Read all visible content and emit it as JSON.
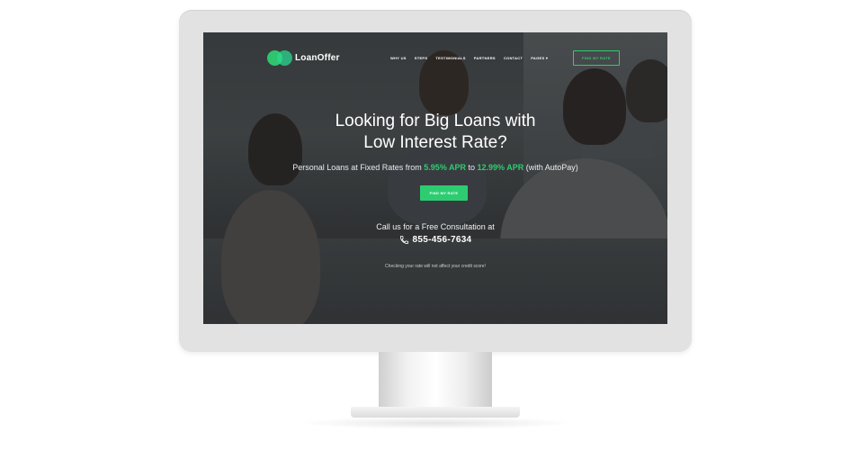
{
  "brand": {
    "name": "LoanOffer",
    "accent_color": "#2ecc71"
  },
  "nav": {
    "items": [
      "WHY US",
      "STEPS",
      "TESTIMONIALS",
      "PARTNERS",
      "CONTACT",
      "PAGES"
    ],
    "cta_label": "FIND MY RATE"
  },
  "hero": {
    "title_line1": "Looking for Big Loans with",
    "title_line2": "Low Interest Rate?",
    "sub_prefix": "Personal Loans at Fixed Rates from",
    "apr_low": "5.95% APR",
    "sub_to": "to",
    "apr_high": "12.99% APR",
    "sub_suffix": "(with AutoPay)",
    "button_label": "FIND MY RATE",
    "consult_text": "Call us for a Free Consultation at",
    "phone": "855-456-7634",
    "disclaimer": "Checking your rate will not affect your credit score!"
  },
  "icons": {
    "phone": "phone-icon",
    "dropdown": "chevron-down-icon"
  }
}
